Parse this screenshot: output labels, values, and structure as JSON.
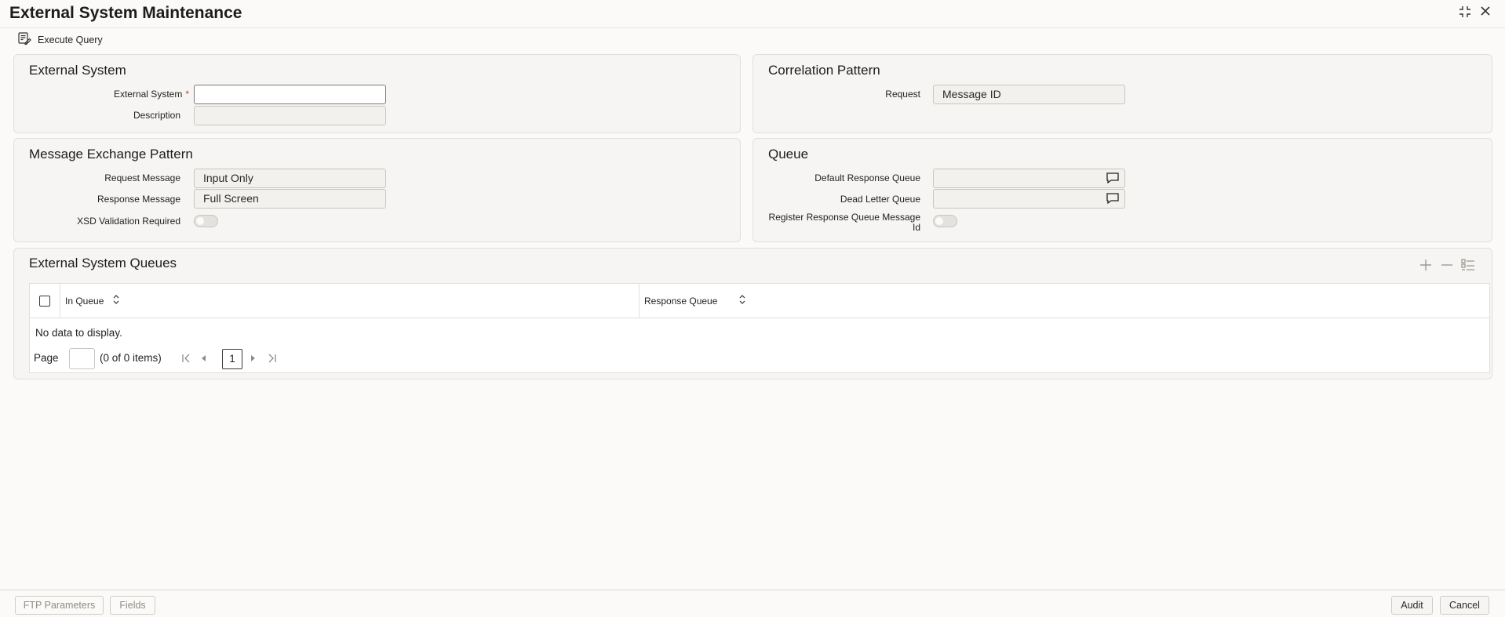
{
  "window": {
    "title": "External System Maintenance"
  },
  "toolbar": {
    "execute_query": "Execute Query"
  },
  "external_system": {
    "heading": "External System",
    "external_system_label": "External System",
    "external_system_value": "",
    "description_label": "Description",
    "description_value": ""
  },
  "correlation": {
    "heading": "Correlation Pattern",
    "request_label": "Request",
    "request_value": "Message ID"
  },
  "message_exchange": {
    "heading": "Message Exchange Pattern",
    "request_message_label": "Request Message",
    "request_message_value": "Input Only",
    "response_message_label": "Response Message",
    "response_message_value": "Full Screen",
    "xsd_label": "XSD Validation Required",
    "xsd_value": false
  },
  "queue": {
    "heading": "Queue",
    "default_response_label": "Default Response Queue",
    "default_response_value": "",
    "dead_letter_label": "Dead Letter Queue",
    "dead_letter_value": "",
    "register_label_line1": "Register Response Queue Message",
    "register_label_line2": "Id",
    "register_value": false
  },
  "queues_table": {
    "heading": "External System Queues",
    "columns": [
      "In Queue",
      "Response Queue"
    ],
    "rows": [],
    "empty_text": "No data to display.",
    "pager": {
      "page_label": "Page",
      "items_text": "(0 of 0 items)",
      "current_page": "1"
    }
  },
  "footer": {
    "ftp_parameters": "FTP Parameters",
    "fields": "Fields",
    "audit": "Audit",
    "cancel": "Cancel"
  },
  "colors": {
    "required": "#c74634",
    "panel_bg": "#f6f5f3",
    "border": "#e1dfdb"
  }
}
